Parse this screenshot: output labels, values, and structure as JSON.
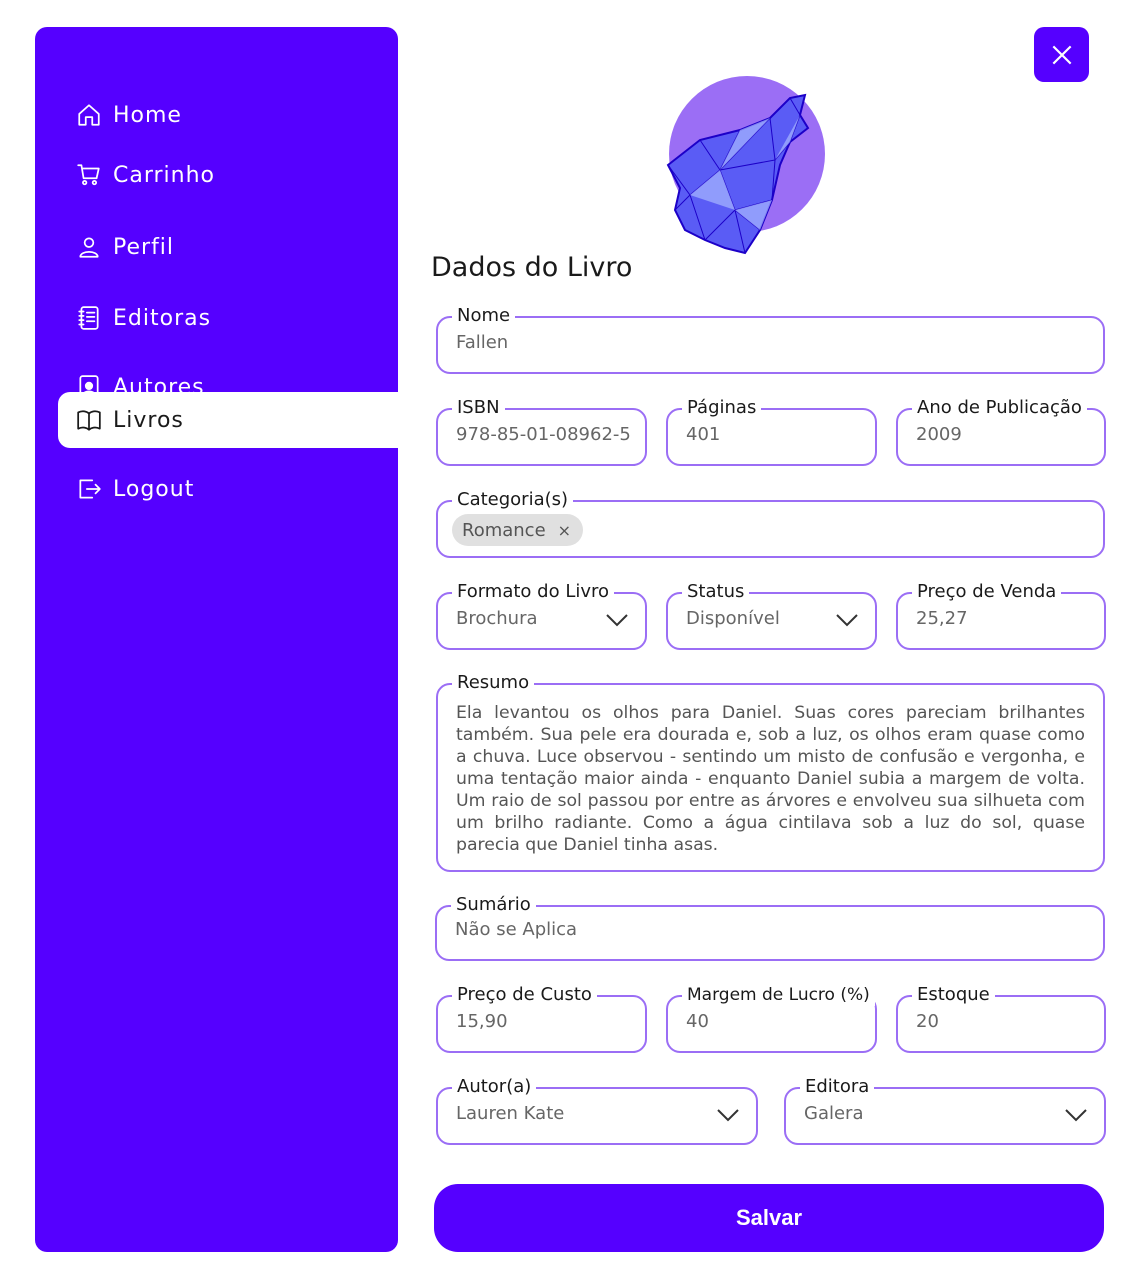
{
  "sidebar": {
    "items": [
      {
        "label": "Home",
        "icon": "home-icon"
      },
      {
        "label": "Carrinho",
        "icon": "cart-icon"
      },
      {
        "label": "Perfil",
        "icon": "user-icon"
      },
      {
        "label": "Editoras",
        "icon": "notebook-icon"
      },
      {
        "label": "Autores",
        "icon": "author-icon"
      },
      {
        "label": "Livros",
        "icon": "book-icon",
        "active": true
      },
      {
        "label": "Logout",
        "icon": "logout-icon"
      }
    ]
  },
  "header": {
    "close_icon": "close-icon"
  },
  "form": {
    "title": "Dados do Livro",
    "nome": {
      "label": "Nome",
      "value": "Fallen"
    },
    "isbn": {
      "label": "ISBN",
      "value": "978-85-01-08962-5"
    },
    "paginas": {
      "label": "Páginas",
      "value": "401"
    },
    "ano": {
      "label": "Ano de Publicação",
      "value": "2009"
    },
    "categorias": {
      "label": "Categoria(s)",
      "chips": [
        "Romance"
      ],
      "remove_glyph": "×"
    },
    "formato": {
      "label": "Formato do Livro",
      "value": "Brochura"
    },
    "status": {
      "label": "Status",
      "value": "Disponível"
    },
    "preco_venda": {
      "label": "Preço de Venda",
      "value": "25,27"
    },
    "resumo": {
      "label": "Resumo",
      "value": "Ela levantou os olhos para Daniel. Suas cores pareciam brilhantes também. Sua pele era dourada e, sob a luz, os olhos eram quase como a chuva. Luce observou - sentindo um misto de confusão e vergonha, e uma tentação maior ainda - enquanto Daniel subia a margem de volta. Um raio de sol passou por entre as árvores e envolveu sua silhueta com um brilho radiante. Como a água cintilava sob a luz do sol, quase parecia que Daniel tinha asas."
    },
    "sumario": {
      "label": "Sumário",
      "value": "Não se Aplica"
    },
    "preco_custo": {
      "label": "Preço de Custo",
      "value": "15,90"
    },
    "margem": {
      "label": "Margem de Lucro (%)",
      "value": "40"
    },
    "estoque": {
      "label": "Estoque",
      "value": "20"
    },
    "autor": {
      "label": "Autor(a)",
      "value": "Lauren Kate"
    },
    "editora": {
      "label": "Editora",
      "value": "Galera"
    },
    "save_label": "Salvar"
  },
  "colors": {
    "accent": "#5500ff",
    "border": "#9b6ef5",
    "logo_circle": "#9b6ef5"
  }
}
